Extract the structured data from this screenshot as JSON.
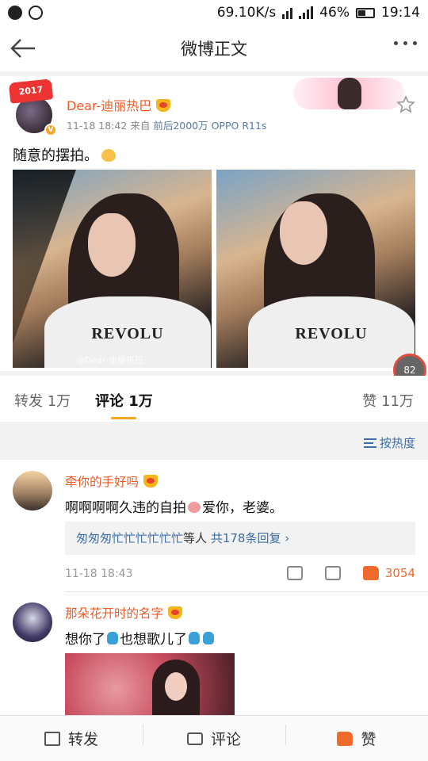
{
  "status_bar": {
    "speed": "69.10K/s",
    "battery": "46%",
    "time": "19:14"
  },
  "nav": {
    "title": "微博正文"
  },
  "post": {
    "author": "Dear-迪丽热巴",
    "hat_text": "2017",
    "time": "11-18 18:42",
    "from_label": "来自",
    "source": "前后2000万 OPPO R11s",
    "text": "随意的摆拍。",
    "shirt_text": "REVOLU",
    "watermark": "@Dear-迪丽热巴",
    "load_progress": "82"
  },
  "tabs": [
    {
      "label": "转发 1万"
    },
    {
      "label": "评论 1万"
    },
    {
      "label": "赞 11万"
    }
  ],
  "sort": {
    "label": "按热度"
  },
  "comments": [
    {
      "name": "牵你的手好吗",
      "text_a": "啊啊啊啊久违的自拍",
      "text_b": "爱你，老婆。",
      "reply_names": "匆匆匆忙忙忙忙忙忙",
      "reply_mid": "等人",
      "reply_count": "共178条回复",
      "time": "11-18 18:43",
      "likes": "3054"
    },
    {
      "name": "那朵花开时的名字",
      "text_a": "想你了",
      "text_b": "也想歌儿了"
    }
  ],
  "bottom_bar": {
    "repost": "转发",
    "comment": "评论",
    "like": "赞"
  },
  "colors": {
    "accent_orange": "#f05a24",
    "link_blue": "#3d6ea8",
    "tab_underline": "#f7a623"
  }
}
